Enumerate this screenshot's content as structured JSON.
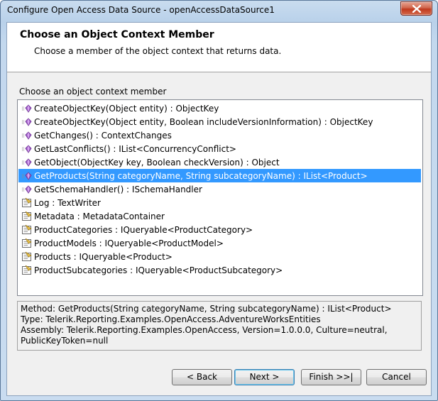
{
  "window": {
    "title": "Configure Open Access Data Source - openAccessDataSource1"
  },
  "header": {
    "title": "Choose an Object Context Member",
    "subtitle": "Choose a member of the object context that returns data."
  },
  "list": {
    "label": "Choose an object context member",
    "items": [
      {
        "text": "CreateObjectKey(Object entity) : ObjectKey",
        "icon": "method-icon"
      },
      {
        "text": "CreateObjectKey(Object entity, Boolean includeVersionInformation) : ObjectKey",
        "icon": "method-icon"
      },
      {
        "text": "GetChanges() : ContextChanges",
        "icon": "method-icon"
      },
      {
        "text": "GetLastConflicts() : IList<ConcurrencyConflict>",
        "icon": "method-icon"
      },
      {
        "text": "GetObject(ObjectKey key, Boolean checkVersion) : Object",
        "icon": "method-icon"
      },
      {
        "text": "GetProducts(String categoryName, String subcategoryName) : IList<Product>",
        "icon": "method-icon",
        "selected": true
      },
      {
        "text": "GetSchemaHandler() : ISchemaHandler",
        "icon": "method-icon"
      },
      {
        "text": "Log : TextWriter",
        "icon": "property-icon"
      },
      {
        "text": "Metadata : MetadataContainer",
        "icon": "property-icon"
      },
      {
        "text": "ProductCategories : IQueryable<ProductCategory>",
        "icon": "property-icon"
      },
      {
        "text": "ProductModels : IQueryable<ProductModel>",
        "icon": "property-icon"
      },
      {
        "text": "Products : IQueryable<Product>",
        "icon": "property-icon"
      },
      {
        "text": "ProductSubcategories : IQueryable<ProductSubcategory>",
        "icon": "property-icon"
      }
    ]
  },
  "info": {
    "line1": "Method: GetProducts(String categoryName, String subcategoryName) : IList<Product>",
    "line2": "Type: Telerik.Reporting.Examples.OpenAccess.AdventureWorksEntities",
    "line3": "Assembly: Telerik.Reporting.Examples.OpenAccess, Version=1.0.0.0, Culture=neutral,",
    "line4": "PublicKeyToken=null"
  },
  "buttons": {
    "back": "< Back",
    "next": "Next >",
    "finish": "Finish >>|",
    "cancel": "Cancel"
  },
  "colors": {
    "selection": "#3399ff",
    "method_icon": "#a05ec9",
    "property_icon": "#e8c04a"
  }
}
